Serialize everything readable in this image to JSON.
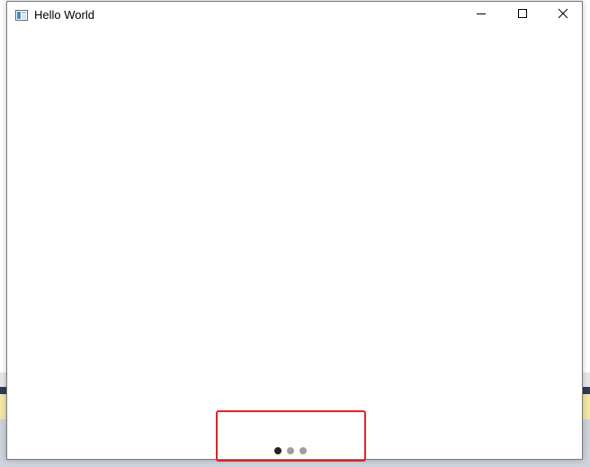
{
  "window": {
    "title": "Hello World",
    "icon": "window-app-icon"
  },
  "titlebar_buttons": {
    "minimize": "minimize-icon",
    "maximize": "maximize-icon",
    "close": "close-icon"
  },
  "page_indicator": {
    "count": 3,
    "active_index": 0,
    "active_color": "#222222",
    "inactive_color": "#9e9e9e"
  },
  "highlight": {
    "color": "#e62020"
  }
}
